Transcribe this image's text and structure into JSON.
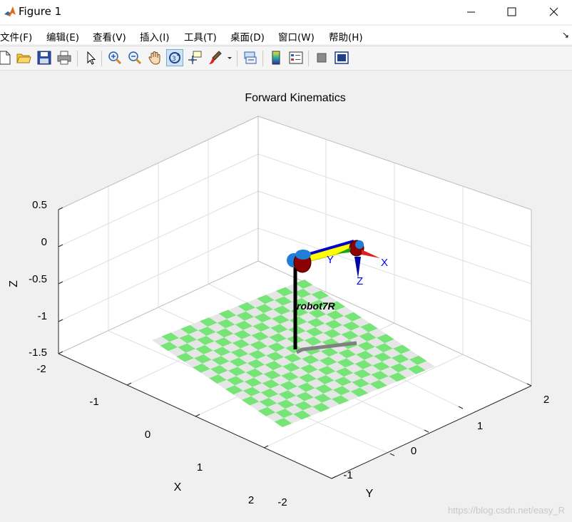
{
  "window": {
    "title": "Figure 1"
  },
  "menu": {
    "items": [
      "文件(F)",
      "编辑(E)",
      "查看(V)",
      "插入(I)",
      "工具(T)",
      "桌面(D)",
      "窗口(W)",
      "帮助(H)"
    ]
  },
  "toolbar": {
    "buttons": [
      "new-figure",
      "open-file",
      "save",
      "print",
      "edit-plot",
      "zoom-in",
      "zoom-out",
      "pan",
      "rotate-3d",
      "data-cursor",
      "brush",
      "link-plot",
      "insert-colorbar",
      "insert-legend",
      "hide-plot-tools",
      "show-plot-tools"
    ],
    "active": "rotate-3d"
  },
  "plot": {
    "title": "Forward Kinematics",
    "xlabel": "X",
    "ylabel": "Y",
    "zlabel": "Z",
    "z_ticks": [
      "0.5",
      "0",
      "-0.5",
      "-1",
      "-1.5"
    ],
    "x_ticks": [
      "-2",
      "-1",
      "0",
      "1",
      "2"
    ],
    "y_ticks": [
      "-2",
      "-1",
      "0",
      "1",
      "2"
    ],
    "robot_label": "robot7R",
    "frame_labels": {
      "x": "X",
      "y": "Y",
      "z": "Z"
    },
    "colors": {
      "floor_green": "#77e477",
      "floor_gray": "#e6e6e6",
      "axis_blue": "#0000ff"
    }
  },
  "watermark": "https://blog.csdn.net/easy_R"
}
